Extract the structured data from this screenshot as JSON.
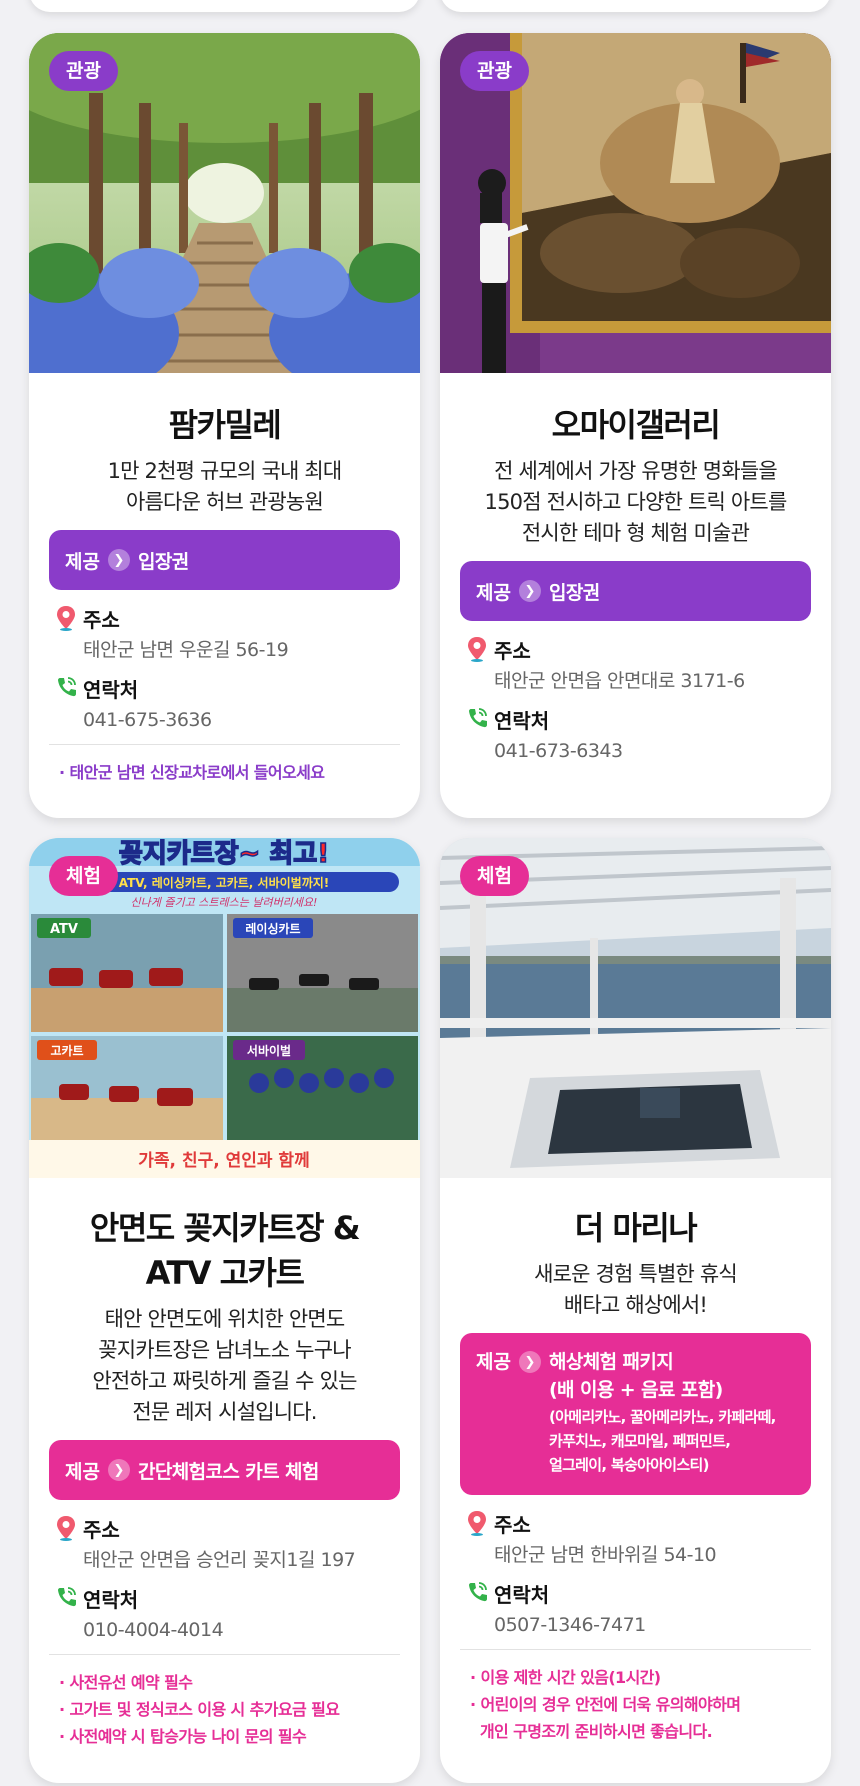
{
  "colors": {
    "purple": "#8a3cc9",
    "pink": "#e62e96",
    "muted": "#666666"
  },
  "cards": [
    {
      "badge": "관광",
      "title": "팜카밀레",
      "desc": [
        "1만 2천평 규모의 국내 최대",
        "아름다운 허브 관광농원"
      ],
      "offer_prefix": "제공",
      "offer_value": "입장권",
      "address_label": "주소",
      "address": "태안군 남면 우운길 56-19",
      "contact_label": "연락처",
      "contact": "041-675-3636",
      "notes": [
        "· 태안군 남면 신장교차로에서 들어오세요"
      ],
      "image_icon": "hydrangea-path-photo"
    },
    {
      "badge": "관광",
      "title": "오마이갤러리",
      "desc": [
        "전 세계에서 가장 유명한 명화들을",
        "150점 전시하고 다양한 트릭 아트를",
        "전시한 테마 형 체험 미술관"
      ],
      "offer_prefix": "제공",
      "offer_value": "입장권",
      "address_label": "주소",
      "address": "태안군 안면읍 안면대로 3171-6",
      "contact_label": "연락처",
      "contact": "041-673-6343",
      "notes": [],
      "image_icon": "gallery-painting-photo"
    },
    {
      "badge": "체험",
      "title": [
        "안면도 꽂지카트장 &",
        "ATV 고카트"
      ],
      "desc": [
        "태안 안면도에 위치한 안면도",
        "꽂지카트장은 남녀노소 누구나",
        "안전하고 짜릿하게 즐길 수 있는",
        "전문 레저 시설입니다."
      ],
      "offer_prefix": "제공",
      "offer_value": "간단체험코스 카트 체험",
      "address_label": "주소",
      "address": "태안군 안면읍 승언리 꽂지1길 197",
      "contact_label": "연락처",
      "contact": "010-4004-4014",
      "notes": [
        "· 사전유선 예약 필수",
        "· 고가트 및 정식코스 이용 시 추가요금 필요",
        "· 사전예약 시 탑승가능 나이 문의 필수"
      ],
      "image_icon": "kart-poster-photo",
      "poster": {
        "headline": "꽂지카트장~ 최고!",
        "sub": "ATV, 레이싱카트, 고카트, 서바이벌까지!",
        "tagline": "신나게 즐기고 스트레스는 날려버리세요!",
        "panels": [
          "ATV",
          "레이싱카트",
          "고카트",
          "서바이벌"
        ],
        "footer": "가족, 친구, 연인과 함께"
      }
    },
    {
      "badge": "체험",
      "title": "더 마리나",
      "desc": [
        "새로운 경험 특별한 휴식",
        "배타고 해상에서!"
      ],
      "offer_prefix": "제공",
      "offer_value": "해상체험 패키지",
      "offer_value2": "(배 이용 + 음료 포함)",
      "offer_detail": [
        "(아메리카노, 꿀아메리카노, 카페라떼,",
        "카푸치노, 캐모마일, 페퍼민트,",
        "얼그레이, 복숭아아이스티)"
      ],
      "address_label": "주소",
      "address": "태안군 남면 한바위길 54-10",
      "contact_label": "연락처",
      "contact": "0507-1346-7471",
      "notes": [
        "· 이용 제한 시간 있음(1시간)",
        "· 어린이의 경우 안전에 더욱 유의해야하며",
        "  개인 구명조끼 준비하시면 좋습니다."
      ],
      "image_icon": "marina-deck-photo"
    }
  ]
}
